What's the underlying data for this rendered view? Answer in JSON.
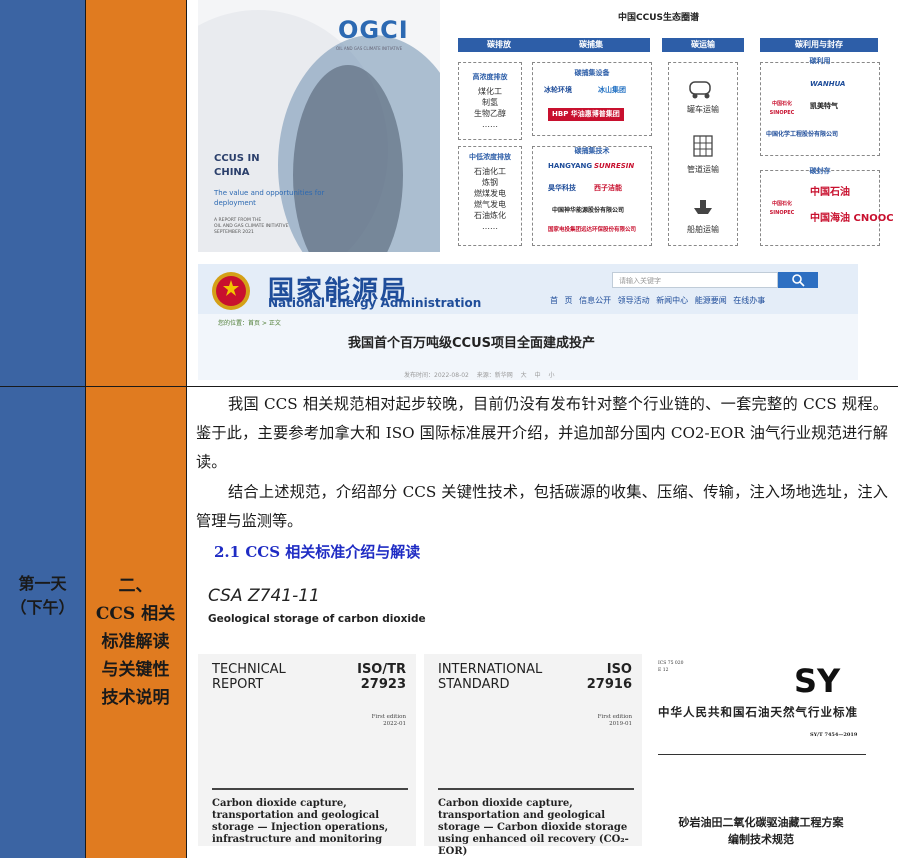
{
  "left_column": {
    "day": "第一天",
    "period": "（下午）"
  },
  "mid_column": {
    "number": "二、",
    "line1": "CCS 相关",
    "line2": "标准解读",
    "line3": "与关键性",
    "line4": "技术说明"
  },
  "report_cover": {
    "brand": "OGCI",
    "brand_sub": "OIL AND GAS CLIMATE INITIATIVE",
    "title_line1": "CCUS IN",
    "title_line2": "CHINA",
    "subtitle": "The value and opportunities for deployment",
    "footnote_line1": "A REPORT FROM THE",
    "footnote_line2": "OIL AND GAS CLIMATE INITIATIVE",
    "footnote_line3": "SEPTEMBER 2021"
  },
  "ecosystem": {
    "title": "中国CCUS生态圈谱",
    "headers": [
      "碳排放",
      "碳捕集",
      "碳运输",
      "碳利用与封存"
    ],
    "high_conc_label": "高浓度排放",
    "high_conc_items": [
      "煤化工",
      "制氢",
      "生物乙醇",
      "……"
    ],
    "low_conc_label": "中低浓度排放",
    "low_conc_items": [
      "石油化工",
      "炼钢",
      "燃煤发电",
      "燃气发电",
      "石油炼化",
      "……"
    ],
    "capture_equipment_label": "碳捕集设备",
    "capture_tech_label": "碳捕集技术",
    "capture_equipment_logos": [
      "冰轮环境",
      "冰山集团",
      "HBP 华油惠博普集团"
    ],
    "capture_tech_logos": [
      "HANGYANG",
      "SUNRESIN",
      "昊华科技",
      "西子洁能",
      "中国神华能源股份有限公司",
      "国家电投集团远达环保股份有限公司"
    ],
    "transport_items": [
      "罐车运输",
      "管道运输",
      "船舶运输"
    ],
    "utilization_label": "碳利用",
    "storage_label": "碳封存",
    "utilization_logos": [
      "WANHUA",
      "中国石化 SINOPEC",
      "凯美特气",
      "中国化学工程股份有限公司"
    ],
    "storage_logos": [
      "中国石化 SINOPEC",
      "中国石油",
      "中国海油 CNOOC"
    ]
  },
  "nea": {
    "title_cn": "国家能源局",
    "title_en": "National Energy Administration",
    "search_placeholder": "请输入关键字",
    "nav": [
      "首 页",
      "信息公开",
      "领导活动",
      "新闻中心",
      "能源要闻",
      "在线办事"
    ],
    "breadcrumb": "您的位置：首页 > 正文",
    "article_title": "我国首个百万吨级CCUS项目全面建成投产",
    "meta": "发布时间：2022-08-02  来源：新华网  大 中 小"
  },
  "body": {
    "para1": "我国 CCS 相关规范相对起步较晚，目前仍没有发布针对整个行业链的、一套完整的 CCS 规程。鉴于此，主要参考加拿大和 ISO 国际标准展开介绍，并追加部分国内 CO2-EOR 油气行业规范进行解读。",
    "para2": "结合上述规范，介绍部分 CCS 关键性技术，包括碳源的收集、压缩、传输，注入场地选址，注入管理与监测等。",
    "section_title": "2.1 CCS 相关标准介绍与解读"
  },
  "csa": {
    "code": "CSA Z741-11",
    "title": "Geological storage of carbon dioxide"
  },
  "iso_tr": {
    "kind_line1": "TECHNICAL",
    "kind_line2": "REPORT",
    "num_line1": "ISO/TR",
    "num_line2": "27923",
    "edition_line1": "First edition",
    "edition_line2": "2022-01",
    "title": "Carbon dioxide capture, transportation and geological storage — Injection operations, infrastructure and monitoring"
  },
  "iso_std": {
    "kind_line1": "INTERNATIONAL",
    "kind_line2": "STANDARD",
    "num_line1": "ISO",
    "num_line2": "27916",
    "edition_line1": "First edition",
    "edition_line2": "2019-01",
    "title": "Carbon dioxide capture, transportation and geological storage — Carbon dioxide storage using enhanced oil recovery (CO₂-EOR)"
  },
  "sy": {
    "ics_line1": "ICS 75 020",
    "ics_line2": "E 12",
    "logo": "SY",
    "org": "中华人民共和国石油天然气行业标准",
    "code": "SY/T 7454—2019",
    "title_line1": "砂岩油田二氧化碳驱油藏工程方案",
    "title_line2": "编制技术规范"
  }
}
